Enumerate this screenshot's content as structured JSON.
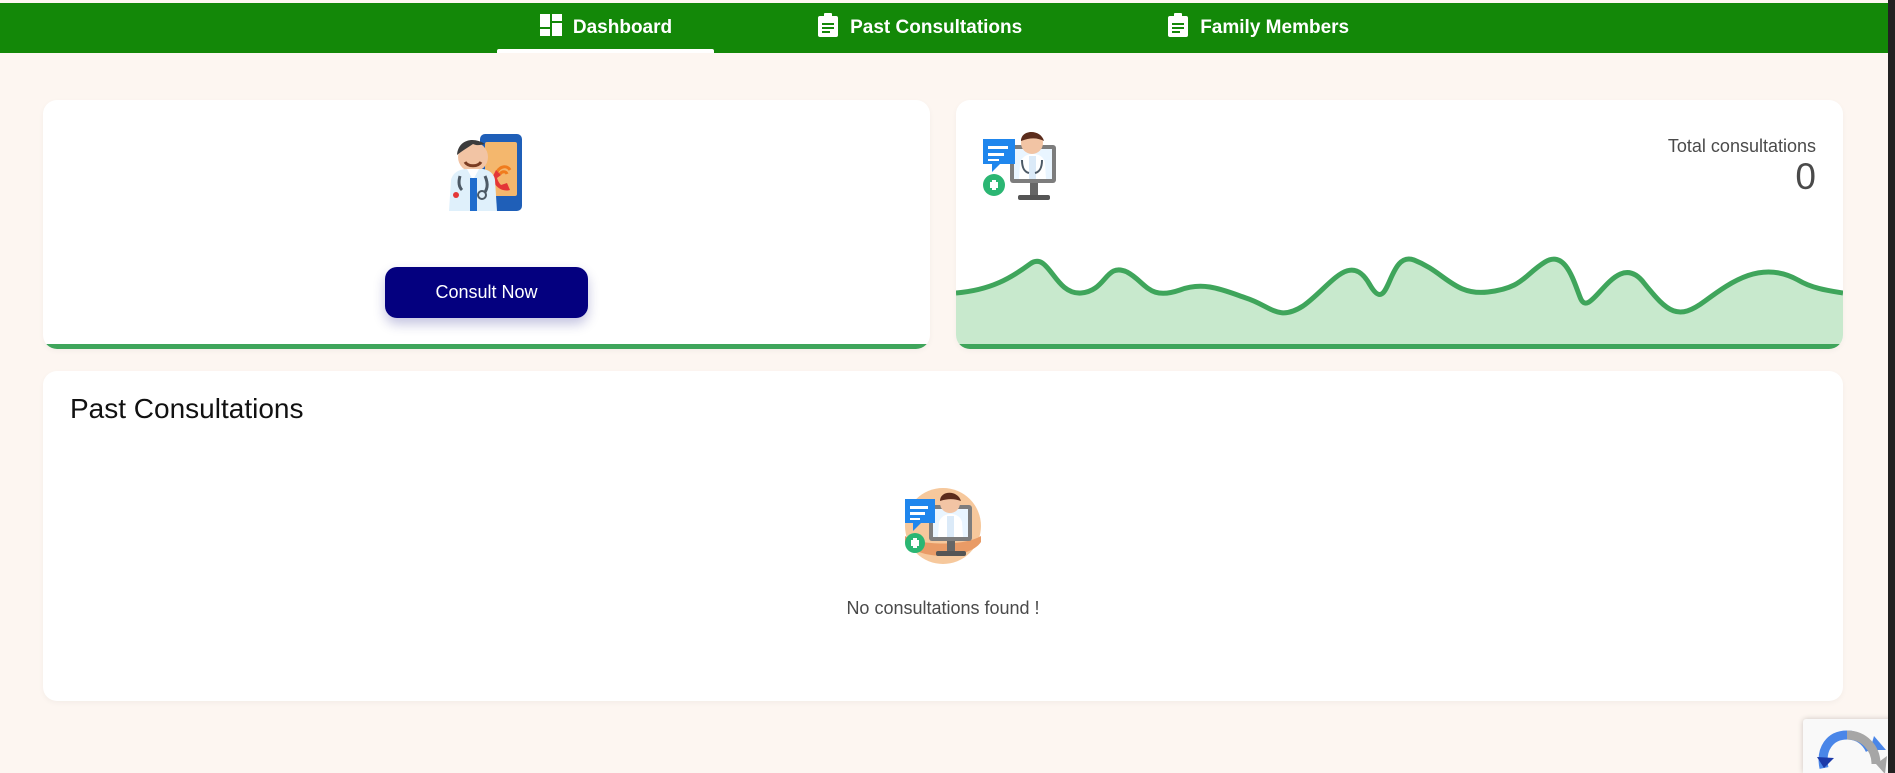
{
  "nav": {
    "items": [
      {
        "label": "Dashboard",
        "icon": "dashboard-icon"
      },
      {
        "label": "Past Consultations",
        "icon": "clipboard-icon"
      },
      {
        "label": "Family Members",
        "icon": "clipboard-icon"
      }
    ]
  },
  "consult": {
    "button_label": "Consult Now",
    "illustration": "doctor-phone-icon"
  },
  "stats": {
    "label": "Total consultations",
    "value": "0",
    "illustration": "doctor-monitor-icon",
    "colors": {
      "line": "#3fa55b",
      "fill": "#c8e9cd"
    }
  },
  "history": {
    "title": "Past Consultations",
    "empty_text": "No consultations found !",
    "illustration": "doctor-monitor-icon"
  },
  "colors": {
    "topbar": "#138808",
    "page_background": "#fdf6f1",
    "primary_button": "#04007f",
    "accent": "#3fa55b"
  }
}
